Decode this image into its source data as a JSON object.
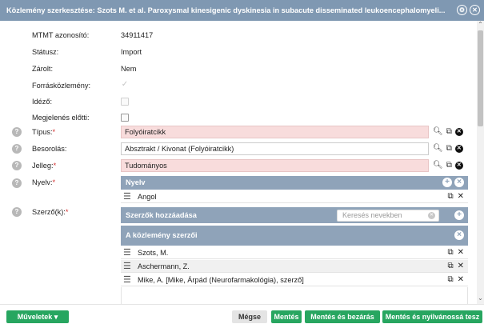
{
  "window": {
    "title": "Közlemény szerkesztése: Szots M. et al. Paroxysmal kinesigenic dyskinesia in subacute disseminated leukoencephalomyeli..."
  },
  "fields": {
    "mtmt_label": "MTMT azonosító:",
    "mtmt_value": "34911417",
    "status_label": "Státusz:",
    "status_value": "Import",
    "locked_label": "Zárolt:",
    "locked_value": "Nem",
    "source_label": "Forrásközlemény:",
    "source_checked": true,
    "citing_label": "Idéző:",
    "citing_checked": false,
    "prepub_label": "Megjelenés előtti:",
    "prepub_checked": false,
    "type_label": "Típus:",
    "type_value": "Folyóiratcikk",
    "class_label": "Besorolás:",
    "class_value": "Absztrakt / Kivonat (Folyóiratcikk)",
    "char_label": "Jelleg:",
    "char_value": "Tudományos",
    "lang_label": "Nyelv:",
    "authors_label": "Szerző(k):",
    "required_mark": "*"
  },
  "language_panel": {
    "title": "Nyelv",
    "items": [
      "Angol"
    ]
  },
  "authors_add_panel": {
    "title": "Szerzők hozzáadása"
  },
  "authors_panel": {
    "title": "A közlemény szerzői",
    "search_placeholder": "Keresés nevekben",
    "items": [
      "Szots, M.",
      "Aschermann, Z.",
      "Mike, A. [Mike, Árpád (Neurofarmakológia), szerző]"
    ]
  },
  "buttons": {
    "actions": "Műveletek",
    "cancel": "Mégse",
    "save": "Mentés",
    "save_close": "Mentés és bezárás",
    "save_publish": "Mentés és nyilvánossá tesz"
  },
  "icons": {
    "settings": "gear-icon",
    "close": "close-icon",
    "help": "help-icon",
    "search": "search-icon",
    "edit": "edit-icon",
    "clear": "clear-icon",
    "drag": "drag-handle-icon",
    "add": "plus-icon",
    "remove": "x-icon"
  },
  "colors": {
    "titlebar": "#7f98b2",
    "panel_header": "#8fa3b9",
    "required_bg": "#f8dcdc",
    "button_green": "#27a660"
  }
}
